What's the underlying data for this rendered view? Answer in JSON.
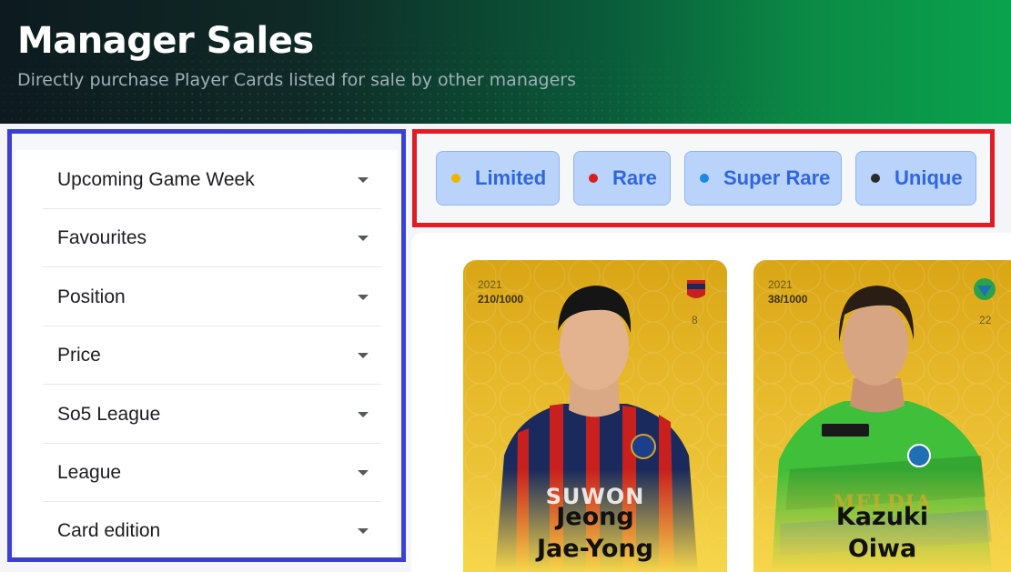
{
  "header": {
    "title": "Manager Sales",
    "subtitle": "Directly purchase Player Cards listed for sale by other managers"
  },
  "sidebar": {
    "filters": [
      {
        "label": "Upcoming Game Week"
      },
      {
        "label": "Favourites"
      },
      {
        "label": "Position"
      },
      {
        "label": "Price"
      },
      {
        "label": "So5 League"
      },
      {
        "label": "League"
      },
      {
        "label": "Card edition"
      }
    ]
  },
  "rarity_tabs": [
    {
      "label": "Limited",
      "dot_color": "#f0b400"
    },
    {
      "label": "Rare",
      "dot_color": "#d81e1e"
    },
    {
      "label": "Super Rare",
      "dot_color": "#1e88e5"
    },
    {
      "label": "Unique",
      "dot_color": "#2a2a2a"
    }
  ],
  "cards": [
    {
      "season": "2021",
      "serial": "210/1000",
      "jersey_number": "8",
      "name_line1": "Jeong",
      "name_line2": "Jae-Yong",
      "club_icon": "suwon-crest-icon",
      "kit_text": "SUWON",
      "kit_colors": [
        "#1b2a5c",
        "#c8201e"
      ]
    },
    {
      "season": "2021",
      "serial": "38/1000",
      "jersey_number": "22",
      "name_line1": "Kazuki",
      "name_line2": "Oiwa",
      "club_icon": "shonan-crest-icon",
      "kit_text": "MELDIA",
      "kit_colors": [
        "#3fbf3a",
        "#1f6fb5"
      ]
    }
  ]
}
